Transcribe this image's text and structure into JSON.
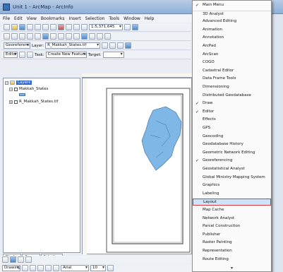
{
  "window": {
    "title": "Unit 1 - ArcMap - ArcInfo"
  },
  "menubar": [
    "File",
    "Edit",
    "View",
    "Bookmarks",
    "Insert",
    "Selection",
    "Tools",
    "Window",
    "Help"
  ],
  "toolbar": {
    "scale": "1:5,371,645",
    "georeferencing_label": "Georeferencing",
    "layer_label": "Layer:",
    "layer_value": "R_Makkah_States.tif",
    "editor_label": "Editor",
    "task_label": "Task:",
    "task_value": "Create New Feature",
    "target_label": "Target:"
  },
  "toc": {
    "root": "Layers",
    "layers": [
      "Makkah_States",
      "R_Makkah_States.tif"
    ],
    "tabs": [
      "Display",
      "Source",
      "Selection"
    ]
  },
  "drawbar": {
    "drawing_label": "Drawing",
    "font": "Arial",
    "font_size": "10"
  },
  "menu": {
    "items": [
      {
        "label": "Main Menu",
        "checked": true
      },
      {
        "label": "3D Analyst",
        "checked": false
      },
      {
        "label": "Advanced Editing",
        "checked": false
      },
      {
        "label": "Animation",
        "checked": false
      },
      {
        "label": "Annotation",
        "checked": false
      },
      {
        "label": "ArcPad",
        "checked": false
      },
      {
        "label": "ArcScan",
        "checked": false
      },
      {
        "label": "COGO",
        "checked": false
      },
      {
        "label": "Cadastral Editor",
        "checked": false
      },
      {
        "label": "Data Frame Tools",
        "checked": false
      },
      {
        "label": "Dimensioning",
        "checked": false
      },
      {
        "label": "Distributed Geodatabase",
        "checked": false
      },
      {
        "label": "Draw",
        "checked": true
      },
      {
        "label": "Editor",
        "checked": true
      },
      {
        "label": "Effects",
        "checked": false
      },
      {
        "label": "GPS",
        "checked": false
      },
      {
        "label": "Geocoding",
        "checked": false
      },
      {
        "label": "Geodatabase History",
        "checked": false
      },
      {
        "label": "Geometric Network Editing",
        "checked": false
      },
      {
        "label": "Georeferencing",
        "checked": true
      },
      {
        "label": "Geostatistical Analyst",
        "checked": false
      },
      {
        "label": "Global Ministry Mapping System",
        "checked": false
      },
      {
        "label": "Graphics",
        "checked": false
      },
      {
        "label": "Labeling",
        "checked": false
      },
      {
        "label": "Layout",
        "checked": false,
        "highlighted": true
      },
      {
        "label": "Map Cache",
        "checked": false
      },
      {
        "label": "Network Analyst",
        "checked": false
      },
      {
        "label": "Parcel Construction",
        "checked": false
      },
      {
        "label": "Publisher",
        "checked": false
      },
      {
        "label": "Raster Painting",
        "checked": false
      },
      {
        "label": "Representation",
        "checked": false
      },
      {
        "label": "Route Editing",
        "checked": false
      }
    ],
    "more_glyph": "▾"
  },
  "colors": {
    "highlight_border": "#d93a3a",
    "highlight_fill": "#cfe3fb",
    "map_fill": "#7fb7e6"
  }
}
